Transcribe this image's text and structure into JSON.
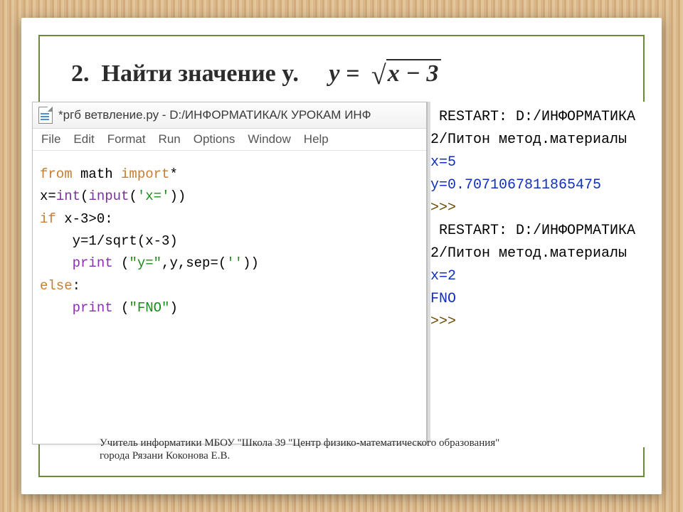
{
  "heading": {
    "number": "2.",
    "text": "Найти значение y.",
    "formula_lhs": "y =",
    "formula_radicand": "x − 3"
  },
  "editor": {
    "title": "*ргб ветвление.ру - D:/ИНФОРМАТИКА/К УРОКАМ ИНФ",
    "menu": [
      "File",
      "Edit",
      "Format",
      "Run",
      "Options",
      "Window",
      "Help"
    ],
    "code": {
      "l1_from": "from",
      "l1_math": " math ",
      "l1_import": "import",
      "l1_star": "*",
      "l2_a": "x=",
      "l2_int": "int",
      "l2_b": "(",
      "l2_input": "input",
      "l2_c": "(",
      "l2_str": "'x='",
      "l2_d": "))",
      "l3_if": "if",
      "l3_cond": " x-3>0:",
      "l4": "    y=1/sqrt(x-3)",
      "l5_indent": "    ",
      "l5_print": "print",
      "l5_args_a": " (",
      "l5_str1": "\"y=\"",
      "l5_args_b": ",y,sep=(",
      "l5_str2": "''",
      "l5_args_c": "))",
      "l6_else": "else",
      "l6_colon": ":",
      "l7_indent": "    ",
      "l7_print": "print",
      "l7_a": " (",
      "l7_str": "\"FNO\"",
      "l7_b": ")"
    }
  },
  "output": {
    "r1": " RESTART: D:/ИНФОРМАТИКА",
    "r2": "2/Питон метод.материалы",
    "x1": "x=5",
    "y1": "y=0.7071067811865475",
    "p1": ">>> ",
    "r3": " RESTART: D:/ИНФОРМАТИКА",
    "r4": "2/Питон метод.материалы",
    "x2": "x=2",
    "fno": "FNO",
    "p2": ">>> "
  },
  "footer": {
    "l1": "Учитель информатики МБОУ \"Школа 39 \"Центр физико-математического образования\"",
    "l2": "города Рязани Коконова Е.В."
  }
}
